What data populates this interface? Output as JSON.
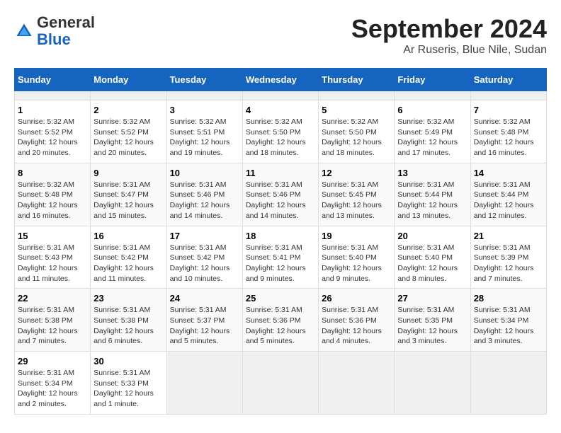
{
  "header": {
    "logo_general": "General",
    "logo_blue": "Blue",
    "month_title": "September 2024",
    "subtitle": "Ar Ruseris, Blue Nile, Sudan"
  },
  "calendar": {
    "days_of_week": [
      "Sunday",
      "Monday",
      "Tuesday",
      "Wednesday",
      "Thursday",
      "Friday",
      "Saturday"
    ],
    "weeks": [
      [
        {
          "day": "",
          "empty": true
        },
        {
          "day": "",
          "empty": true
        },
        {
          "day": "",
          "empty": true
        },
        {
          "day": "",
          "empty": true
        },
        {
          "day": "",
          "empty": true
        },
        {
          "day": "",
          "empty": true
        },
        {
          "day": "",
          "empty": true
        }
      ],
      [
        {
          "day": "1",
          "sunrise": "5:32 AM",
          "sunset": "5:52 PM",
          "daylight": "12 hours and 20 minutes."
        },
        {
          "day": "2",
          "sunrise": "5:32 AM",
          "sunset": "5:52 PM",
          "daylight": "12 hours and 20 minutes."
        },
        {
          "day": "3",
          "sunrise": "5:32 AM",
          "sunset": "5:51 PM",
          "daylight": "12 hours and 19 minutes."
        },
        {
          "day": "4",
          "sunrise": "5:32 AM",
          "sunset": "5:50 PM",
          "daylight": "12 hours and 18 minutes."
        },
        {
          "day": "5",
          "sunrise": "5:32 AM",
          "sunset": "5:50 PM",
          "daylight": "12 hours and 18 minutes."
        },
        {
          "day": "6",
          "sunrise": "5:32 AM",
          "sunset": "5:49 PM",
          "daylight": "12 hours and 17 minutes."
        },
        {
          "day": "7",
          "sunrise": "5:32 AM",
          "sunset": "5:48 PM",
          "daylight": "12 hours and 16 minutes."
        }
      ],
      [
        {
          "day": "8",
          "sunrise": "5:32 AM",
          "sunset": "5:48 PM",
          "daylight": "12 hours and 16 minutes."
        },
        {
          "day": "9",
          "sunrise": "5:31 AM",
          "sunset": "5:47 PM",
          "daylight": "12 hours and 15 minutes."
        },
        {
          "day": "10",
          "sunrise": "5:31 AM",
          "sunset": "5:46 PM",
          "daylight": "12 hours and 14 minutes."
        },
        {
          "day": "11",
          "sunrise": "5:31 AM",
          "sunset": "5:46 PM",
          "daylight": "12 hours and 14 minutes."
        },
        {
          "day": "12",
          "sunrise": "5:31 AM",
          "sunset": "5:45 PM",
          "daylight": "12 hours and 13 minutes."
        },
        {
          "day": "13",
          "sunrise": "5:31 AM",
          "sunset": "5:44 PM",
          "daylight": "12 hours and 13 minutes."
        },
        {
          "day": "14",
          "sunrise": "5:31 AM",
          "sunset": "5:44 PM",
          "daylight": "12 hours and 12 minutes."
        }
      ],
      [
        {
          "day": "15",
          "sunrise": "5:31 AM",
          "sunset": "5:43 PM",
          "daylight": "12 hours and 11 minutes."
        },
        {
          "day": "16",
          "sunrise": "5:31 AM",
          "sunset": "5:42 PM",
          "daylight": "12 hours and 11 minutes."
        },
        {
          "day": "17",
          "sunrise": "5:31 AM",
          "sunset": "5:42 PM",
          "daylight": "12 hours and 10 minutes."
        },
        {
          "day": "18",
          "sunrise": "5:31 AM",
          "sunset": "5:41 PM",
          "daylight": "12 hours and 9 minutes."
        },
        {
          "day": "19",
          "sunrise": "5:31 AM",
          "sunset": "5:40 PM",
          "daylight": "12 hours and 9 minutes."
        },
        {
          "day": "20",
          "sunrise": "5:31 AM",
          "sunset": "5:40 PM",
          "daylight": "12 hours and 8 minutes."
        },
        {
          "day": "21",
          "sunrise": "5:31 AM",
          "sunset": "5:39 PM",
          "daylight": "12 hours and 7 minutes."
        }
      ],
      [
        {
          "day": "22",
          "sunrise": "5:31 AM",
          "sunset": "5:38 PM",
          "daylight": "12 hours and 7 minutes."
        },
        {
          "day": "23",
          "sunrise": "5:31 AM",
          "sunset": "5:38 PM",
          "daylight": "12 hours and 6 minutes."
        },
        {
          "day": "24",
          "sunrise": "5:31 AM",
          "sunset": "5:37 PM",
          "daylight": "12 hours and 5 minutes."
        },
        {
          "day": "25",
          "sunrise": "5:31 AM",
          "sunset": "5:36 PM",
          "daylight": "12 hours and 5 minutes."
        },
        {
          "day": "26",
          "sunrise": "5:31 AM",
          "sunset": "5:36 PM",
          "daylight": "12 hours and 4 minutes."
        },
        {
          "day": "27",
          "sunrise": "5:31 AM",
          "sunset": "5:35 PM",
          "daylight": "12 hours and 3 minutes."
        },
        {
          "day": "28",
          "sunrise": "5:31 AM",
          "sunset": "5:34 PM",
          "daylight": "12 hours and 3 minutes."
        }
      ],
      [
        {
          "day": "29",
          "sunrise": "5:31 AM",
          "sunset": "5:34 PM",
          "daylight": "12 hours and 2 minutes."
        },
        {
          "day": "30",
          "sunrise": "5:31 AM",
          "sunset": "5:33 PM",
          "daylight": "12 hours and 1 minute."
        },
        {
          "day": "",
          "empty": true
        },
        {
          "day": "",
          "empty": true
        },
        {
          "day": "",
          "empty": true
        },
        {
          "day": "",
          "empty": true
        },
        {
          "day": "",
          "empty": true
        }
      ]
    ]
  }
}
